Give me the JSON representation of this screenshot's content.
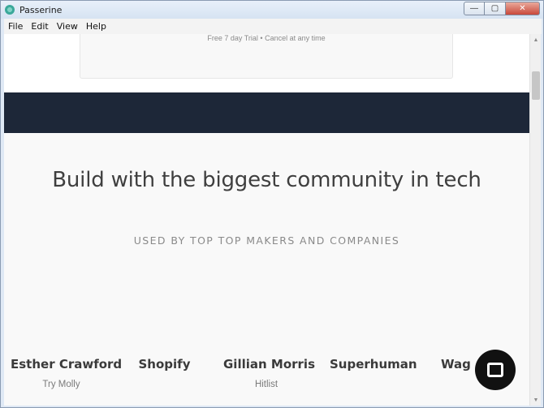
{
  "window": {
    "title": "Passerine",
    "controls": {
      "minimize": "—",
      "maximize": "▢",
      "close": "✕"
    }
  },
  "menubar": {
    "items": [
      "File",
      "Edit",
      "View",
      "Help"
    ]
  },
  "page": {
    "trial_text": "Free 7 day Trial • Cancel at any time",
    "headline": "Build with the biggest community in tech",
    "subheadline": "USED BY TOP TOP MAKERS AND COMPANIES",
    "makers": [
      {
        "name": "Esther Crawford",
        "product": "Try Molly"
      },
      {
        "name": "Shopify",
        "product": ""
      },
      {
        "name": "Gillian Morris",
        "product": "Hitlist"
      },
      {
        "name": "Superhuman",
        "product": ""
      },
      {
        "name": "Wag",
        "product": ""
      }
    ],
    "chat_icon": "chat-bubble-icon"
  },
  "colors": {
    "dark_band": "#1d2738",
    "chat_bubble": "#111111"
  }
}
